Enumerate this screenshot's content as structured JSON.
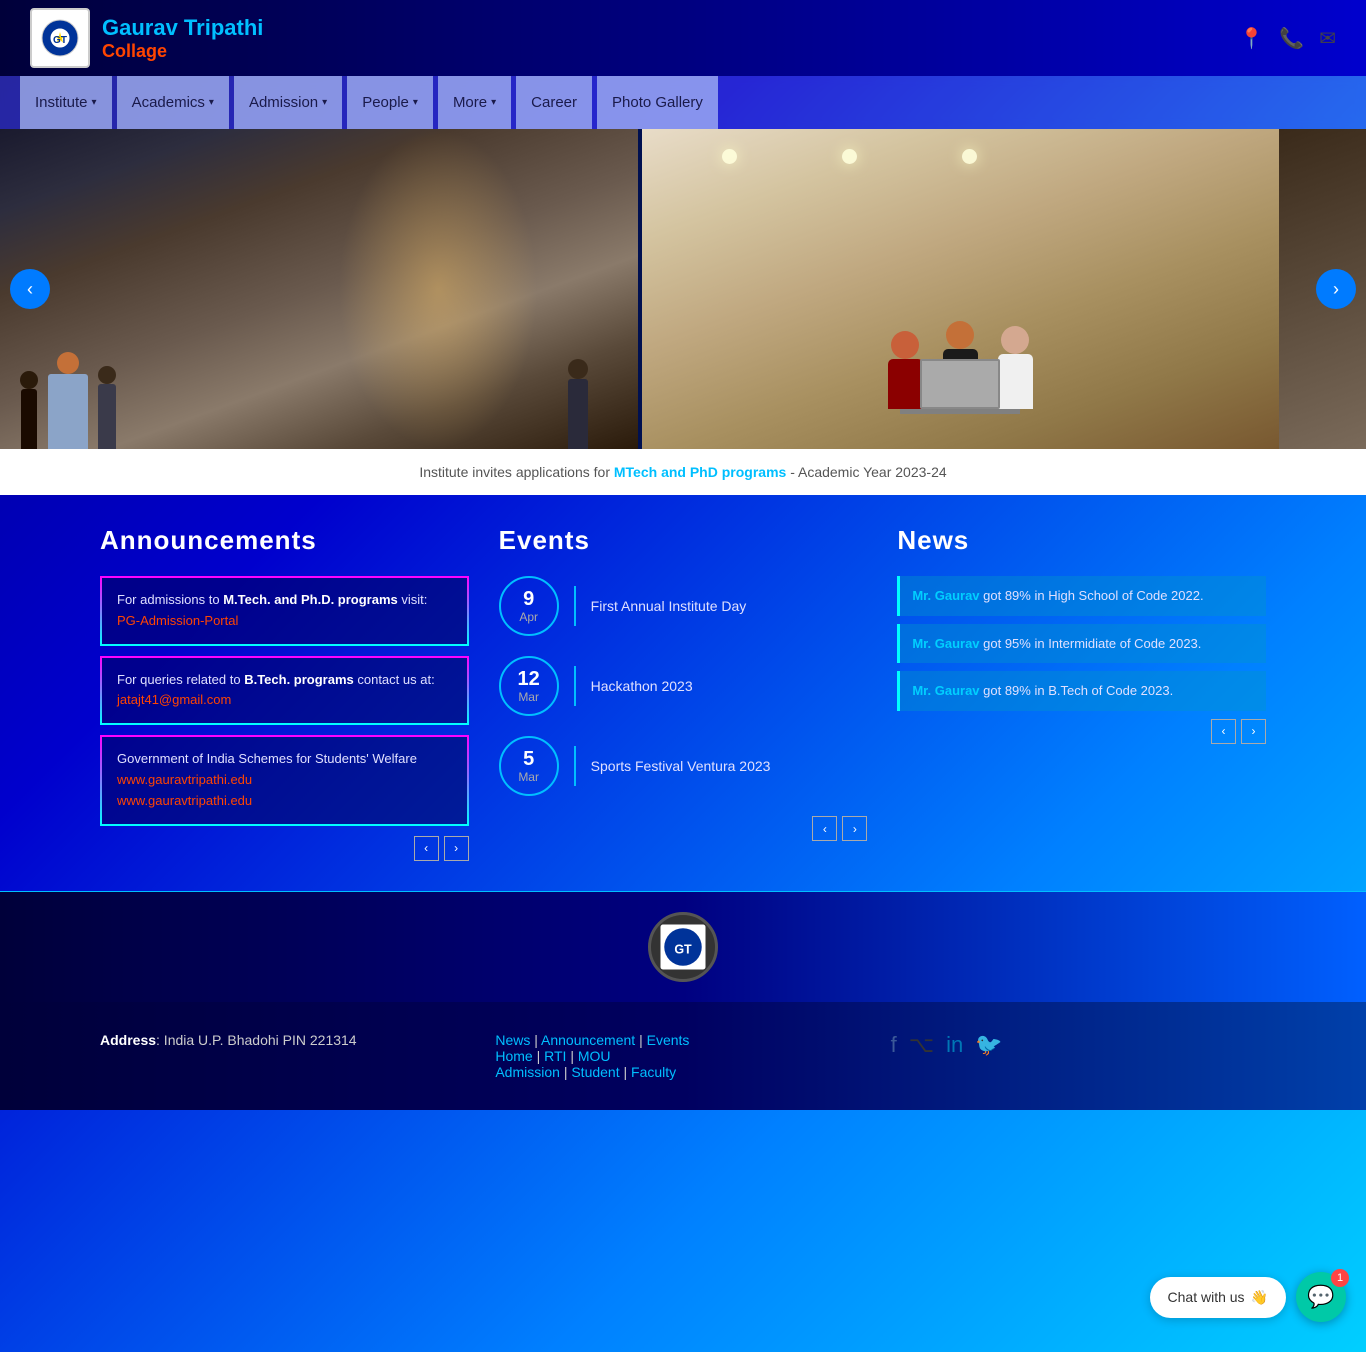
{
  "header": {
    "college_name": "Gaurav Tripathi",
    "college_subtitle": "Collage",
    "icons": [
      "location-icon",
      "phone-icon",
      "email-icon"
    ]
  },
  "nav": {
    "items": [
      {
        "label": "Institute",
        "has_dropdown": true
      },
      {
        "label": "Academics",
        "has_dropdown": true
      },
      {
        "label": "Admission",
        "has_dropdown": true
      },
      {
        "label": "People",
        "has_dropdown": true
      },
      {
        "label": "More",
        "has_dropdown": true
      },
      {
        "label": "Career",
        "has_dropdown": false
      },
      {
        "label": "Photo Gallery",
        "has_dropdown": false
      }
    ]
  },
  "carousel": {
    "prev_label": "‹",
    "next_label": "›"
  },
  "announcement_banner": {
    "text_before": "Institute invites applications for ",
    "highlight": "MTech and PhD programs",
    "text_after": " - Academic Year 2023-24"
  },
  "announcements": {
    "title": "Announcements",
    "items": [
      {
        "text_before": "For admissions to ",
        "bold": "M.Tech. and Ph.D. programs",
        "text_after": " visit:",
        "link_text": "PG-Admission-Portal",
        "link_href": "#"
      },
      {
        "text_before": "For queries related to ",
        "bold": "B.Tech. programs",
        "text_after": " contact us at:",
        "link_text": "jatajt41@gmail.com",
        "link_href": "mailto:jatajt41@gmail.com"
      },
      {
        "text": "Government of India Schemes for Students' Welfare",
        "links": [
          "www.gauravtripathi.edu",
          "www.gauravtripathi.edu"
        ]
      }
    ],
    "prev_label": "‹",
    "next_label": "›"
  },
  "events": {
    "title": "Events",
    "items": [
      {
        "day": "9",
        "month": "Apr",
        "label": "First Annual Institute Day"
      },
      {
        "day": "12",
        "month": "Mar",
        "label": "Hackathon 2023"
      },
      {
        "day": "5",
        "month": "Mar",
        "label": "Sports Festival Ventura 2023"
      }
    ],
    "prev_label": "‹",
    "next_label": "›"
  },
  "news": {
    "title": "News",
    "items": [
      {
        "name": "Mr. Gaurav",
        "text": " got 89% in High School of Code 2022."
      },
      {
        "name": "Mr. Gaurav",
        "text": " got 95% in Intermidiate of Code 2023."
      },
      {
        "name": "Mr. Gaurav",
        "text": " got 89% in B.Tech of Code 2023."
      }
    ],
    "prev_label": "‹",
    "next_label": "›"
  },
  "footer": {
    "address_label": "Address",
    "address_value": ": India U.P. Bhadohi PIN 221314",
    "links_row1": [
      "News",
      "Announcement",
      "Events"
    ],
    "links_row2": [
      "Home",
      "RTI",
      "MOU"
    ],
    "links_row3": [
      "Admission",
      "Student",
      "Faculty"
    ],
    "social_icons": [
      "facebook-icon",
      "github-icon",
      "linkedin-icon",
      "twitter-icon"
    ]
  },
  "chat": {
    "label": "Chat with us",
    "emoji": "👋",
    "badge": "1"
  }
}
